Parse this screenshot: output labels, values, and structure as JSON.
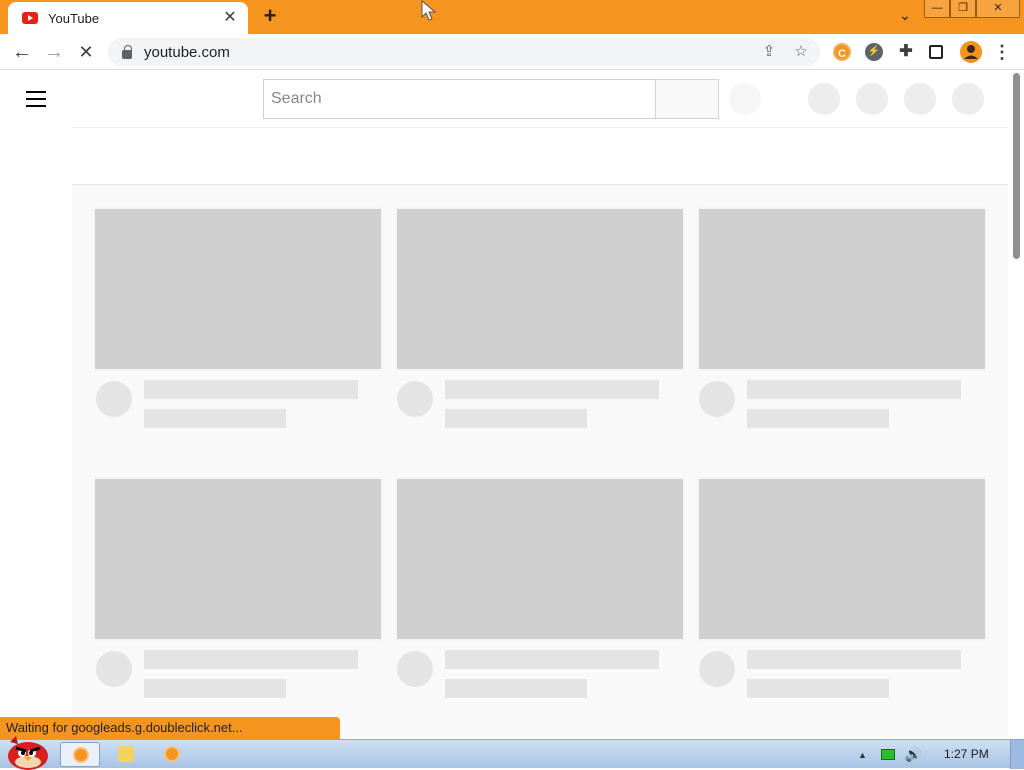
{
  "browser": {
    "tab": {
      "title": "YouTube",
      "close_glyph": "✕"
    },
    "new_tab_glyph": "+",
    "tab_dropdown_glyph": "⌄",
    "window_controls": {
      "minimize": "—",
      "restore": "❐",
      "close": "✕"
    },
    "nav": {
      "back": "←",
      "forward": "→",
      "stop": "✕"
    },
    "address": {
      "url": "youtube.com"
    },
    "omnibox_icons": {
      "share": "⇪",
      "bookmark": "☆"
    },
    "extensions": {
      "coccoc": "C",
      "bolt": "⚡",
      "puzzle": "✚",
      "sidepanel": "▮",
      "menu": "⋮"
    },
    "accent_color": "#f5941e"
  },
  "page": {
    "search": {
      "placeholder": "Search",
      "value": ""
    },
    "skeleton_color": "#cfcfcf",
    "skeleton_light": "#e4e4e4"
  },
  "status_bubble": "Waiting for googleads.g.doubleclick.net...",
  "taskbar": {
    "clock": "1:27 PM"
  }
}
